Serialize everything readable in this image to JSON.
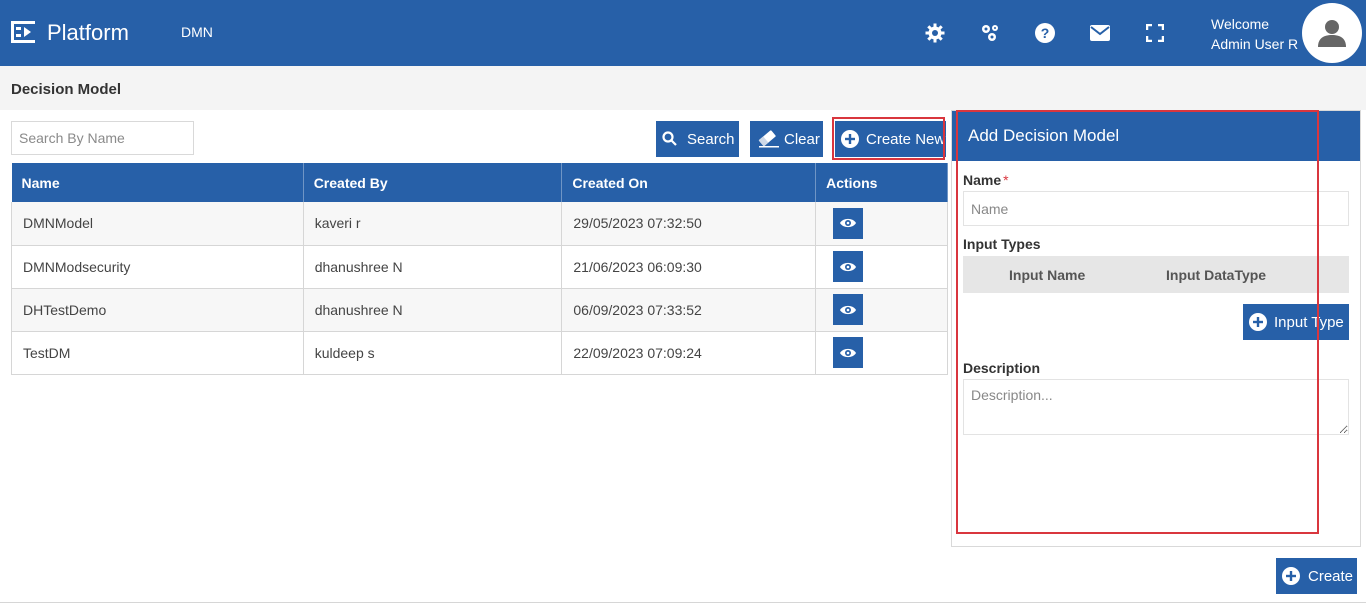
{
  "header": {
    "app_name": "Platform",
    "module": "DMN",
    "welcome": "Welcome",
    "user_name": "Admin User R",
    "icons": [
      "settings-icon",
      "cluster-icon",
      "help-icon",
      "mail-icon",
      "fullscreen-icon"
    ]
  },
  "page": {
    "title": "Decision Model"
  },
  "search": {
    "placeholder": "Search By Name",
    "value": "",
    "search_label": "Search",
    "clear_label": "Clear",
    "create_new_label": "Create New"
  },
  "table": {
    "columns": [
      "Name",
      "Created By",
      "Created On",
      "Actions"
    ],
    "rows": [
      {
        "name": "DMNModel",
        "created_by": "kaveri r",
        "created_on": "29/05/2023 07:32:50"
      },
      {
        "name": "DMNModsecurity",
        "created_by": "dhanushree N",
        "created_on": "21/06/2023 06:09:30"
      },
      {
        "name": "DHTestDemo",
        "created_by": "dhanushree N",
        "created_on": "06/09/2023 07:33:52"
      },
      {
        "name": "TestDM",
        "created_by": "kuldeep s",
        "created_on": "22/09/2023 07:09:24"
      }
    ]
  },
  "panel": {
    "title": "Add Decision Model",
    "name_label": "Name",
    "required_mark": "*",
    "name_placeholder": "Name",
    "input_types_label": "Input Types",
    "input_name_col": "Input Name",
    "input_datatype_col": "Input DataType",
    "input_type_button": "Input Type",
    "description_label": "Description",
    "description_placeholder": "Description..."
  },
  "footer": {
    "create_label": "Create"
  },
  "colors": {
    "primary": "#2760a8",
    "highlight": "#d9363e"
  }
}
